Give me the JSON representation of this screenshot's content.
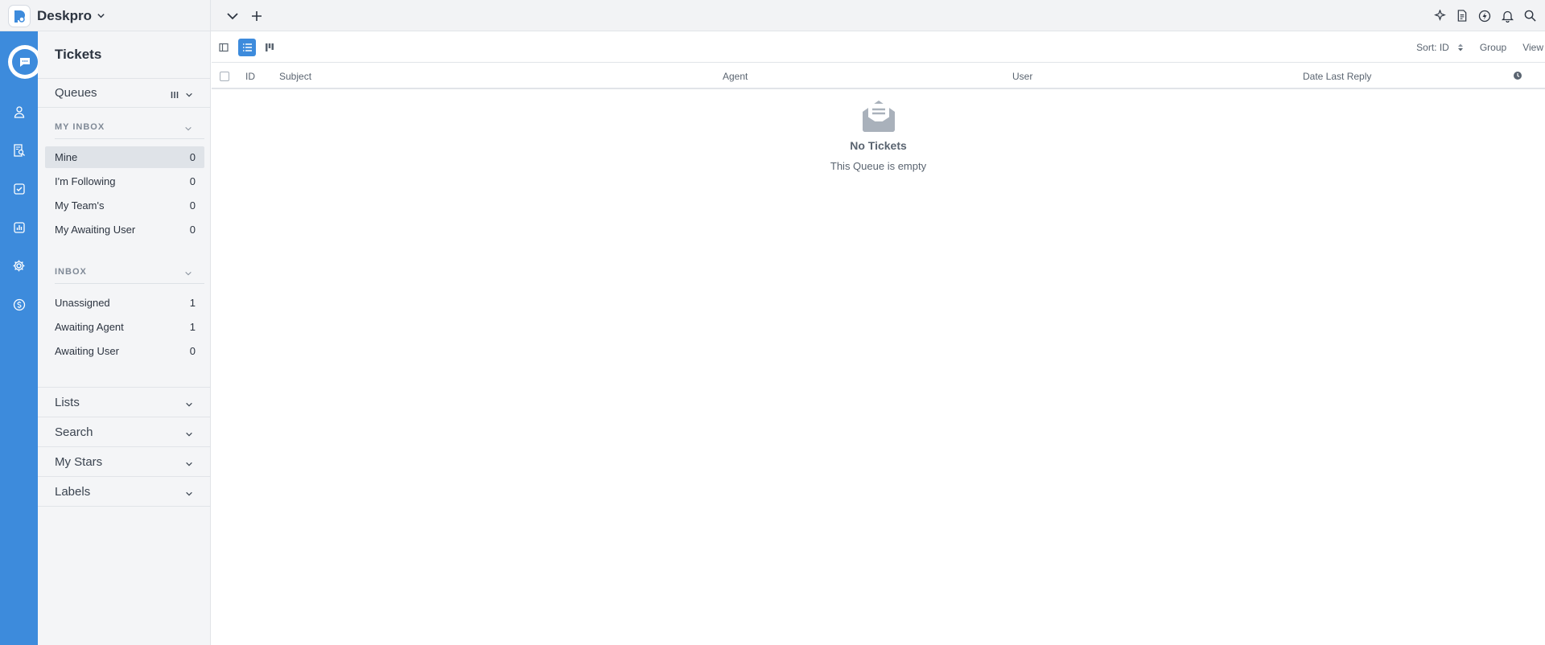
{
  "brand": {
    "name": "Deskpro"
  },
  "topbar": {
    "left_icons": [
      "chevron-down-icon",
      "plus-icon"
    ],
    "right_icons": [
      "sparkle-icon",
      "document-icon",
      "lightning-icon",
      "bell-icon",
      "search-icon"
    ]
  },
  "rail": {
    "items": [
      "tickets-icon",
      "users-icon",
      "knowledgebase-icon",
      "tasks-icon",
      "reports-icon",
      "settings-icon",
      "billing-icon"
    ],
    "active": "tickets-icon",
    "color": "#3d8bdc"
  },
  "sidebar": {
    "title": "Tickets",
    "queues_label": "Queues",
    "my_inbox": {
      "label": "MY INBOX",
      "items": [
        {
          "label": "Mine",
          "count": "0",
          "selected": true
        },
        {
          "label": "I'm Following",
          "count": "0"
        },
        {
          "label": "My Team's",
          "count": "0"
        },
        {
          "label": "My Awaiting User",
          "count": "0"
        }
      ]
    },
    "inbox": {
      "label": "INBOX",
      "items": [
        {
          "label": "Unassigned",
          "count": "1"
        },
        {
          "label": "Awaiting Agent",
          "count": "1"
        },
        {
          "label": "Awaiting User",
          "count": "0"
        }
      ]
    },
    "sections": [
      "Lists",
      "Search",
      "My Stars",
      "Labels"
    ]
  },
  "toolbar": {
    "sort_label": "Sort: ID",
    "group_label": "Group",
    "view_label": "View",
    "view_modes": [
      "sidebar-toggle-icon",
      "list-view-icon",
      "board-view-icon"
    ],
    "active_view": "list-view-icon"
  },
  "table": {
    "columns": [
      "ID",
      "Subject",
      "Agent",
      "User",
      "Date Last Reply"
    ]
  },
  "empty_state": {
    "title": "No Tickets",
    "subtitle": "This Queue is empty"
  }
}
